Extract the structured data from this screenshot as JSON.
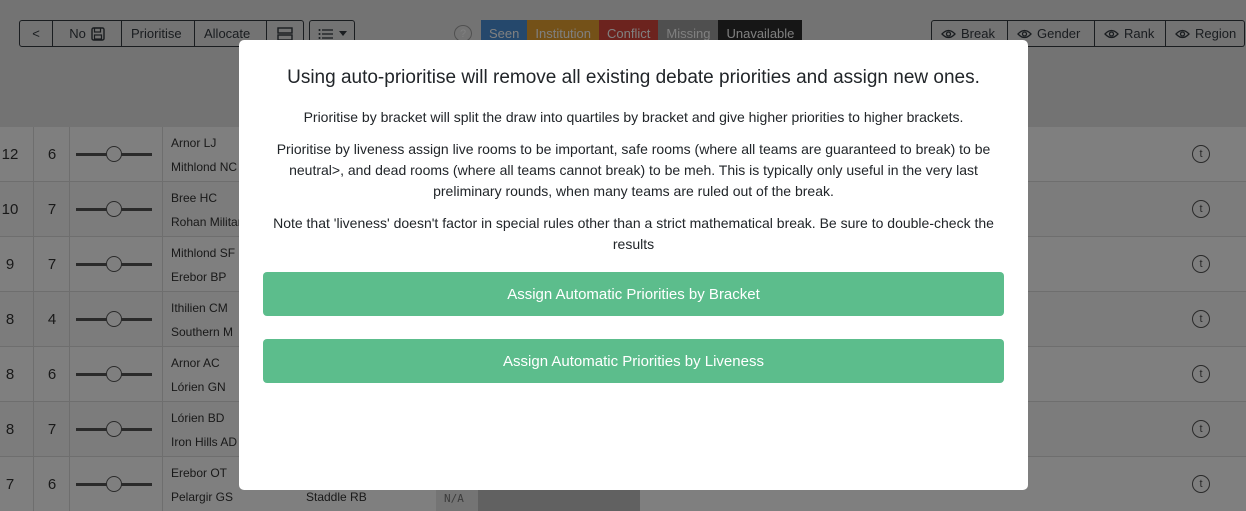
{
  "toolbar": {
    "back_label": "<",
    "no_label": "No",
    "prioritise_label": "Prioritise",
    "allocate_label": "Allocate"
  },
  "legend": [
    {
      "label": "Seen",
      "color": "#4a90d9"
    },
    {
      "label": "Institution",
      "color": "#e8a330"
    },
    {
      "label": "Conflict",
      "color": "#d9463d"
    },
    {
      "label": "Missing",
      "color": "#9e9e9e"
    },
    {
      "label": "Unavailable",
      "color": "#2c2c2c"
    }
  ],
  "view_toggles": [
    {
      "label": "Break"
    },
    {
      "label": "Gender"
    },
    {
      "label": "Rank"
    },
    {
      "label": "Region"
    }
  ],
  "rows": [
    {
      "a": "12",
      "b": "6",
      "team1": "Arnor LJ",
      "team2": "Mithlond NC"
    },
    {
      "a": "10",
      "b": "7",
      "team1": "Bree HC",
      "team2": "Rohan Military"
    },
    {
      "a": "9",
      "b": "7",
      "team1": "Mithlond SF",
      "team2": "Erebor BP"
    },
    {
      "a": "8",
      "b": "4",
      "team1": "Ithilien CM",
      "team2": "Southern M"
    },
    {
      "a": "8",
      "b": "6",
      "team1": "Arnor AC",
      "team2": "Lórien GN"
    },
    {
      "a": "8",
      "b": "7",
      "team1": "Lórien BD",
      "team2": "Iron Hills AD"
    },
    {
      "a": "7",
      "b": "6",
      "team1": "Erebor OT",
      "team2": "Pelargir GS",
      "adjudicator": "Staddle RB",
      "na": "N/A"
    }
  ],
  "modal": {
    "title": "Using auto-prioritise will remove all existing debate priorities and assign new ones.",
    "p1": "Prioritise by bracket will split the draw into quartiles by bracket and give higher priorities to higher brackets.",
    "p2": "Prioritise by liveness assign live rooms to be important, safe rooms (where all teams are guaranteed to break) to be neutral>, and dead rooms (where all teams cannot break) to be meh. This is typically only useful in the very last preliminary rounds, when many teams are ruled out of the break.",
    "p3": "Note that 'liveness' doesn't factor in special rules other than a strict mathematical break. Be sure to double-check the results",
    "bracket_button": "Assign Automatic Priorities by Bracket",
    "liveness_button": "Assign Automatic Priorities by Liveness"
  },
  "colors": {
    "accent_green": "#5cbd8c",
    "toolbar_bg": "#e6e6e6"
  }
}
